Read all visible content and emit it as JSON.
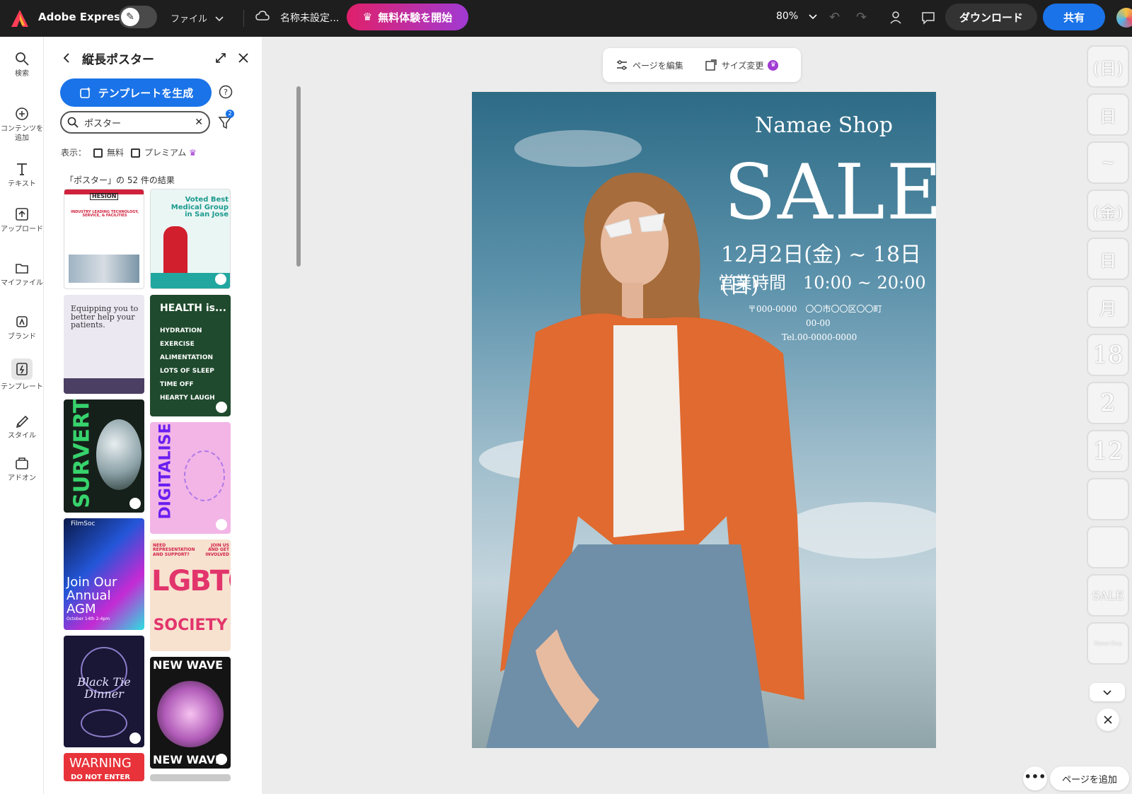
{
  "topbar": {
    "app_name": "Adobe Express",
    "file_menu": "ファイル",
    "doc_name": "名称未設定...",
    "trial_label": "無料体験を開始",
    "zoom": "80%",
    "download_label": "ダウンロード",
    "share_label": "共有"
  },
  "rail": {
    "items": [
      {
        "label": "検索",
        "icon": "search-icon"
      },
      {
        "label": "コンテンツを追加",
        "icon": "plus-circle-icon"
      },
      {
        "label": "テキスト",
        "icon": "text-icon"
      },
      {
        "label": "アップロード",
        "icon": "upload-icon"
      },
      {
        "label": "マイファイル",
        "icon": "folder-icon"
      },
      {
        "label": "ブランド",
        "icon": "brand-icon"
      },
      {
        "label": "テンプレート",
        "icon": "template-icon"
      },
      {
        "label": "スタイル",
        "icon": "style-icon"
      },
      {
        "label": "アドオン",
        "icon": "addon-icon"
      }
    ]
  },
  "panel": {
    "title": "縦長ポスター",
    "generate_label": "テンプレートを生成",
    "search_value": "ポスター",
    "filter_badge": "2",
    "show_label": "表示：",
    "free_label": "無料",
    "premium_label": "プレミアム",
    "results_text": "「ポスター」の 52 件の結果"
  },
  "thumbnails": {
    "t1": {
      "title": "HESION",
      "subtitle": "INDUSTRY LEADING TECHNOLOGY, SERVICE, & FACILITIES"
    },
    "t2": {
      "title": "Voted Best Medical Group in San Jose"
    },
    "t3": {
      "title": "Equipping you to better help your patients."
    },
    "t4": {
      "title": "HEALTH is...",
      "lines": [
        "HYDRATION",
        "EXERCISE",
        "ALIMENTATION",
        "LOTS OF SLEEP",
        "TIME OFF",
        "HEARTY LAUGH"
      ]
    },
    "t5": {
      "title": "SURVERT"
    },
    "t6": {
      "title": "DIGITALISED"
    },
    "t7": {
      "brand": "FilmSoc",
      "title": "Join Our Annual AGM",
      "date": "October 14th 2-4pm"
    },
    "t8": {
      "top_left": "NEED REPRESENTATION AND SUPPORT?",
      "top_right": "JOIN US AND GET INVOLVED",
      "title": "LGBTQ+",
      "subtitle": "SOCIETY"
    },
    "t9": {
      "title": "Black Tie Dinner"
    },
    "t10": {
      "title": "NEW WAVE",
      "bottom": "NEW WAVE"
    },
    "t11": {
      "title": "WARNING",
      "subtitle": "DO NOT ENTER"
    }
  },
  "page_tools": {
    "edit_page": "ページを編集",
    "resize": "サイズ変更"
  },
  "poster": {
    "shop": "Namae Shop",
    "sale": "SALE",
    "dates": "12月2日(金) ~ 18日(日)",
    "hours": "営業時間　10:00 ~ 20:00",
    "address_line1": "〒000-0000　〇〇市〇〇区〇〇町",
    "address_line2": "00-00",
    "tel": "Tel.00-0000-0000"
  },
  "layers": [
    "(日)",
    "日",
    "~",
    "(金)",
    "日",
    "月",
    "18",
    "2",
    "12",
    "",
    "",
    "SALE",
    "Namae Shop"
  ],
  "bottom": {
    "more": "•••",
    "add_page": "ページを追加"
  },
  "colors": {
    "accent_blue": "#1a73e8",
    "trial_gradient_start": "#e0206a",
    "trial_gradient_end": "#a13ad3",
    "topbar_bg": "#1e1e1e"
  }
}
